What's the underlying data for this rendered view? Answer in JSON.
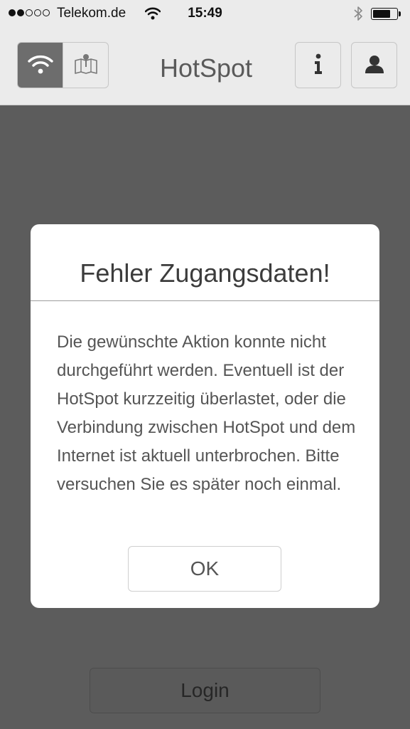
{
  "status_bar": {
    "signal_filled": 2,
    "signal_total": 5,
    "carrier": "Telekom.de",
    "time": "15:49",
    "battery_level": 0.75
  },
  "nav": {
    "title": "HotSpot",
    "segments": [
      {
        "icon": "wifi-icon",
        "active": true
      },
      {
        "icon": "map-icon",
        "active": false
      }
    ],
    "info_icon": "info-icon",
    "profile_icon": "user-icon"
  },
  "dialog": {
    "title": "Fehler Zugangsdaten!",
    "message": "Die gewünschte Aktion konnte nicht durchgeführt werden. Eventuell ist der HotSpot kurzzeitig überlastet, oder die Verbindung zwischen HotSpot und dem Internet ist aktuell unterbrochen. Bitte versuchen Sie es später noch einmal.",
    "ok_label": "OK"
  },
  "login_label": "Login",
  "colors": {
    "overlay_background": "#5c5c5c",
    "bar_background": "#ebebeb",
    "active_segment": "#6d6d6d"
  }
}
